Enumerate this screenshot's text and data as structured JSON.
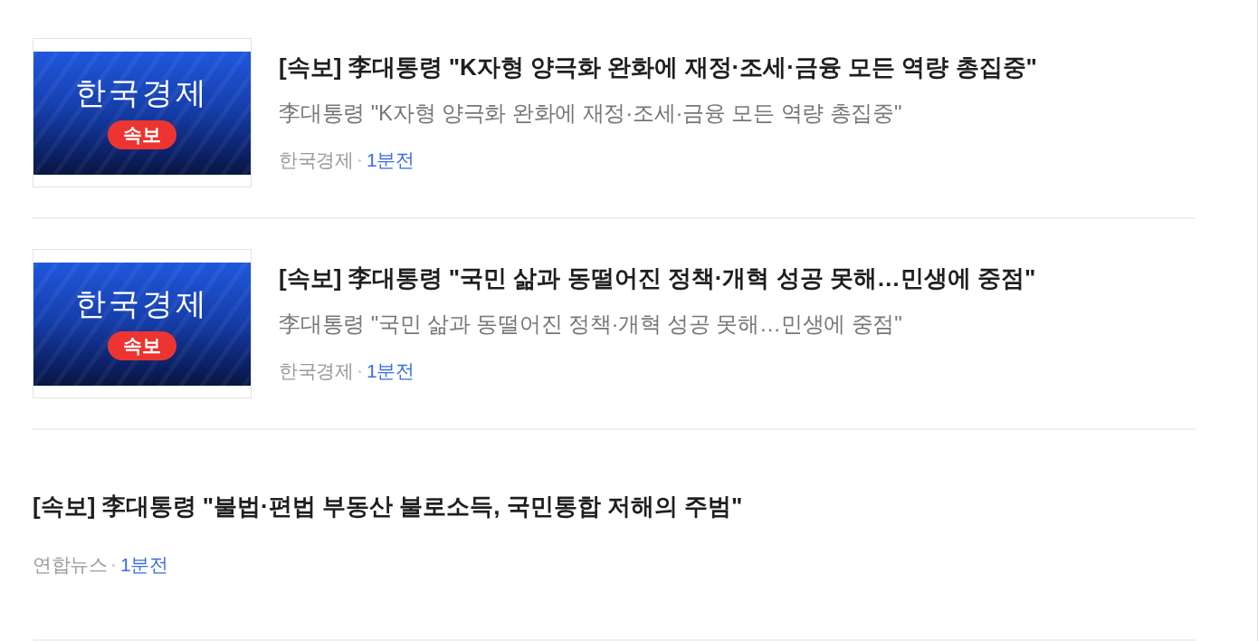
{
  "articles": [
    {
      "kind": "thumbnail",
      "thumbnail": {
        "title": "한국경제",
        "badge": "속보"
      },
      "headline": "[속보] 李대통령 \"K자형 양극화 완화에 재정·조세·금융 모든 역량 총집중\"",
      "summary": "李대통령 \"K자형 양극화 완화에 재정·조세·금융 모든 역량 총집중\"",
      "source": "한국경제",
      "time": "1분전"
    },
    {
      "kind": "thumbnail",
      "thumbnail": {
        "title": "한국경제",
        "badge": "속보"
      },
      "headline": "[속보] 李대통령 \"국민 삶과 동떨어진 정책·개혁 성공 못해…민생에 중점\"",
      "summary": "李대통령 \"국민 삶과 동떨어진 정책·개혁 성공 못해…민생에 중점\"",
      "source": "한국경제",
      "time": "1분전"
    },
    {
      "kind": "text",
      "headline": "[속보] 李대통령 \"불법·편법 부동산 불로소득, 국민통합 저해의 주범\"",
      "source": "연합뉴스",
      "time": "1분전"
    }
  ]
}
